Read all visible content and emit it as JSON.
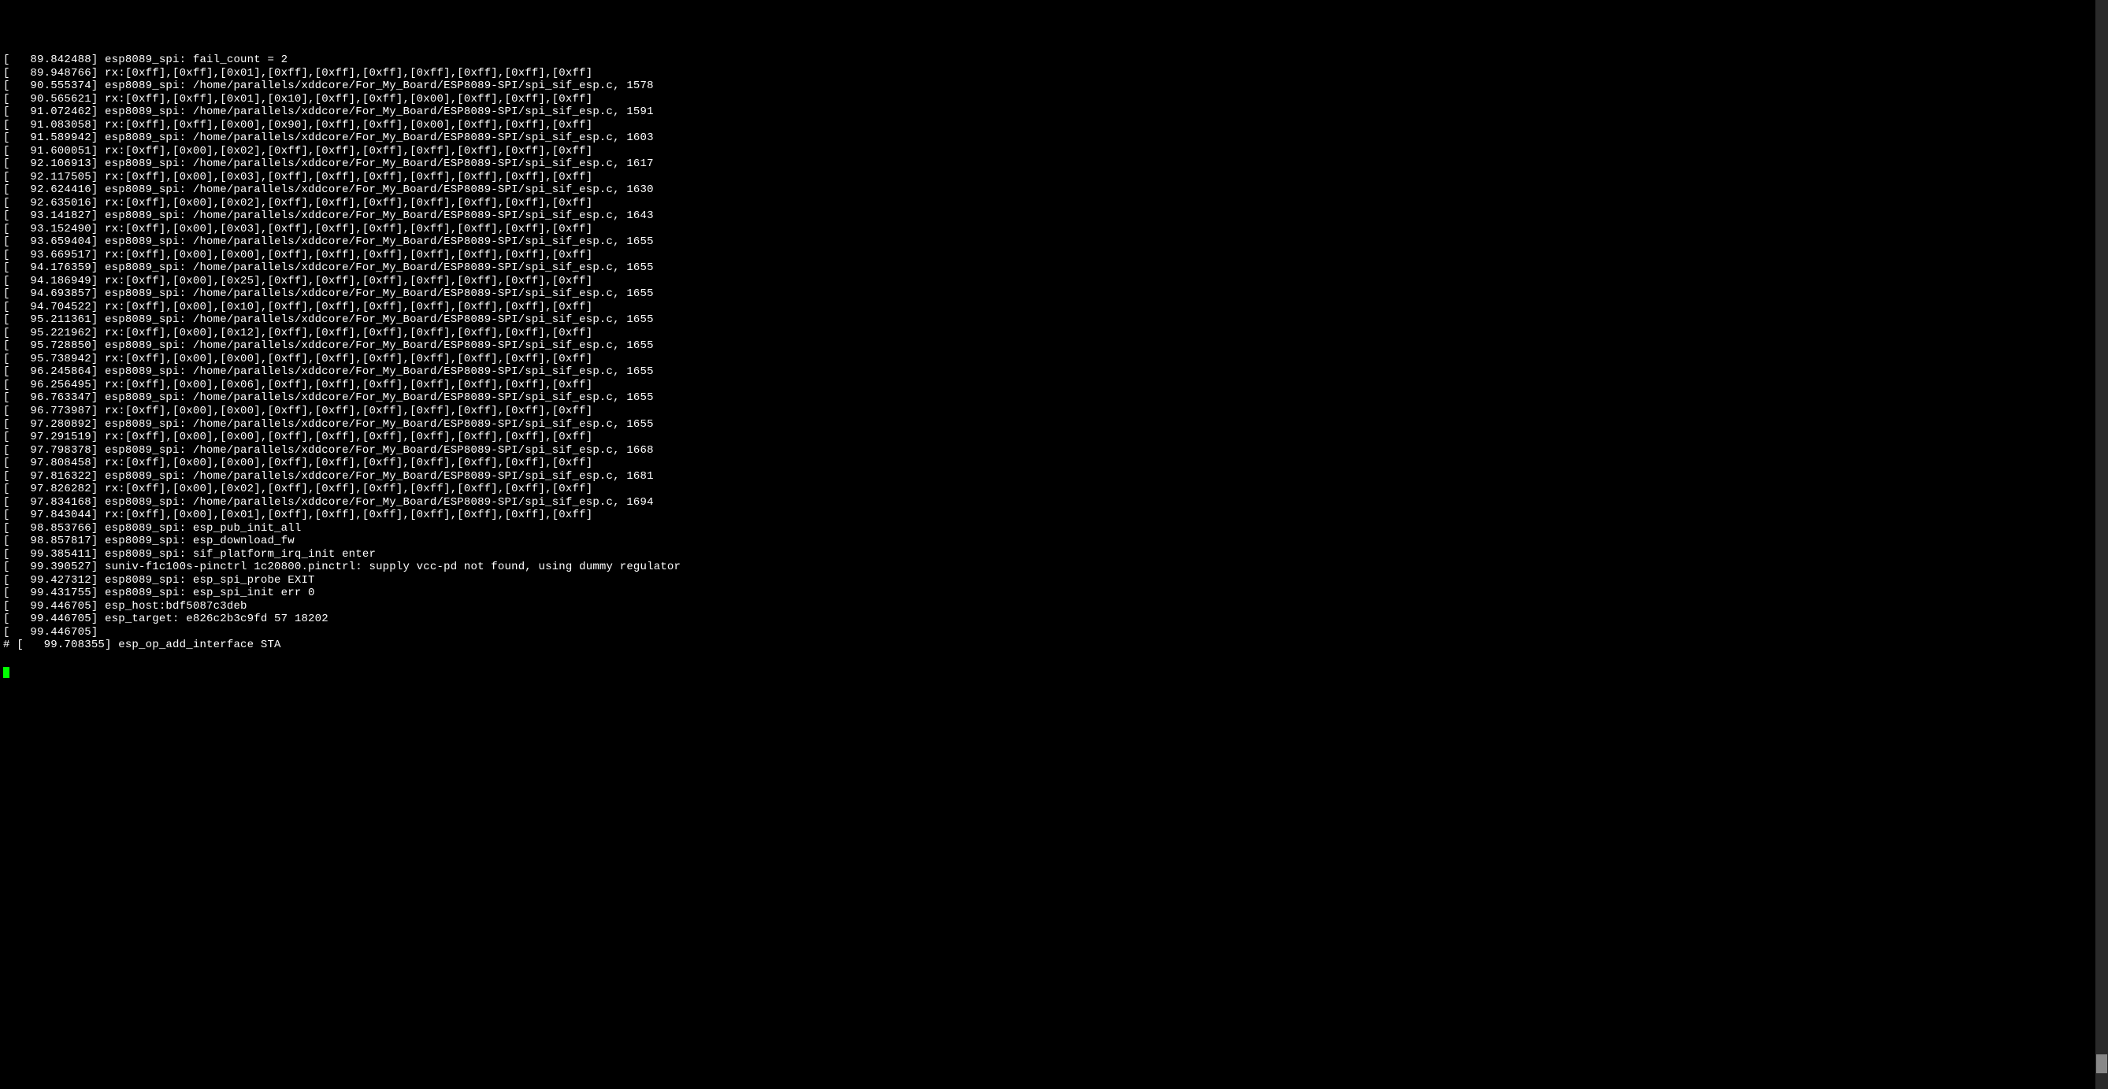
{
  "log_lines": [
    "[   89.842488] esp8089_spi: fail_count = 2",
    "[   89.948766] rx:[0xff],[0xff],[0x01],[0xff],[0xff],[0xff],[0xff],[0xff],[0xff],[0xff]",
    "[   90.555374] esp8089_spi: /home/parallels/xddcore/For_My_Board/ESP8089-SPI/spi_sif_esp.c, 1578",
    "[   90.565621] rx:[0xff],[0xff],[0x01],[0x10],[0xff],[0xff],[0x00],[0xff],[0xff],[0xff]",
    "[   91.072462] esp8089_spi: /home/parallels/xddcore/For_My_Board/ESP8089-SPI/spi_sif_esp.c, 1591",
    "[   91.083058] rx:[0xff],[0xff],[0x00],[0x90],[0xff],[0xff],[0x00],[0xff],[0xff],[0xff]",
    "[   91.589942] esp8089_spi: /home/parallels/xddcore/For_My_Board/ESP8089-SPI/spi_sif_esp.c, 1603",
    "[   91.600051] rx:[0xff],[0x00],[0x02],[0xff],[0xff],[0xff],[0xff],[0xff],[0xff],[0xff]",
    "[   92.106913] esp8089_spi: /home/parallels/xddcore/For_My_Board/ESP8089-SPI/spi_sif_esp.c, 1617",
    "[   92.117505] rx:[0xff],[0x00],[0x03],[0xff],[0xff],[0xff],[0xff],[0xff],[0xff],[0xff]",
    "[   92.624416] esp8089_spi: /home/parallels/xddcore/For_My_Board/ESP8089-SPI/spi_sif_esp.c, 1630",
    "[   92.635016] rx:[0xff],[0x00],[0x02],[0xff],[0xff],[0xff],[0xff],[0xff],[0xff],[0xff]",
    "[   93.141827] esp8089_spi: /home/parallels/xddcore/For_My_Board/ESP8089-SPI/spi_sif_esp.c, 1643",
    "[   93.152490] rx:[0xff],[0x00],[0x03],[0xff],[0xff],[0xff],[0xff],[0xff],[0xff],[0xff]",
    "[   93.659404] esp8089_spi: /home/parallels/xddcore/For_My_Board/ESP8089-SPI/spi_sif_esp.c, 1655",
    "[   93.669517] rx:[0xff],[0x00],[0x00],[0xff],[0xff],[0xff],[0xff],[0xff],[0xff],[0xff]",
    "[   94.176359] esp8089_spi: /home/parallels/xddcore/For_My_Board/ESP8089-SPI/spi_sif_esp.c, 1655",
    "[   94.186949] rx:[0xff],[0x00],[0x25],[0xff],[0xff],[0xff],[0xff],[0xff],[0xff],[0xff]",
    "[   94.693857] esp8089_spi: /home/parallels/xddcore/For_My_Board/ESP8089-SPI/spi_sif_esp.c, 1655",
    "[   94.704522] rx:[0xff],[0x00],[0x10],[0xff],[0xff],[0xff],[0xff],[0xff],[0xff],[0xff]",
    "[   95.211361] esp8089_spi: /home/parallels/xddcore/For_My_Board/ESP8089-SPI/spi_sif_esp.c, 1655",
    "[   95.221962] rx:[0xff],[0x00],[0x12],[0xff],[0xff],[0xff],[0xff],[0xff],[0xff],[0xff]",
    "[   95.728850] esp8089_spi: /home/parallels/xddcore/For_My_Board/ESP8089-SPI/spi_sif_esp.c, 1655",
    "[   95.738942] rx:[0xff],[0x00],[0x00],[0xff],[0xff],[0xff],[0xff],[0xff],[0xff],[0xff]",
    "[   96.245864] esp8089_spi: /home/parallels/xddcore/For_My_Board/ESP8089-SPI/spi_sif_esp.c, 1655",
    "[   96.256495] rx:[0xff],[0x00],[0x06],[0xff],[0xff],[0xff],[0xff],[0xff],[0xff],[0xff]",
    "[   96.763347] esp8089_spi: /home/parallels/xddcore/For_My_Board/ESP8089-SPI/spi_sif_esp.c, 1655",
    "[   96.773987] rx:[0xff],[0x00],[0x00],[0xff],[0xff],[0xff],[0xff],[0xff],[0xff],[0xff]",
    "[   97.280892] esp8089_spi: /home/parallels/xddcore/For_My_Board/ESP8089-SPI/spi_sif_esp.c, 1655",
    "[   97.291519] rx:[0xff],[0x00],[0x00],[0xff],[0xff],[0xff],[0xff],[0xff],[0xff],[0xff]",
    "[   97.798378] esp8089_spi: /home/parallels/xddcore/For_My_Board/ESP8089-SPI/spi_sif_esp.c, 1668",
    "[   97.808458] rx:[0xff],[0x00],[0x00],[0xff],[0xff],[0xff],[0xff],[0xff],[0xff],[0xff]",
    "[   97.816322] esp8089_spi: /home/parallels/xddcore/For_My_Board/ESP8089-SPI/spi_sif_esp.c, 1681",
    "[   97.826282] rx:[0xff],[0x00],[0x02],[0xff],[0xff],[0xff],[0xff],[0xff],[0xff],[0xff]",
    "[   97.834168] esp8089_spi: /home/parallels/xddcore/For_My_Board/ESP8089-SPI/spi_sif_esp.c, 1694",
    "[   97.843044] rx:[0xff],[0x00],[0x01],[0xff],[0xff],[0xff],[0xff],[0xff],[0xff],[0xff]",
    "[   98.853766] esp8089_spi: esp_pub_init_all",
    "[   98.857817] esp8089_spi: esp_download_fw",
    "[   99.385411] esp8089_spi: sif_platform_irq_init enter",
    "[   99.390527] suniv-f1c100s-pinctrl 1c20800.pinctrl: supply vcc-pd not found, using dummy regulator",
    "[   99.427312] esp8089_spi: esp_spi_probe EXIT",
    "[   99.431755] esp8089_spi: esp_spi_init err 0",
    "[   99.446705] esp_host:bdf5087c3deb",
    "[   99.446705] esp_target: e826c2b3c9fd 57 18202",
    "[   99.446705]",
    "# [   99.708355] esp_op_add_interface STA"
  ]
}
